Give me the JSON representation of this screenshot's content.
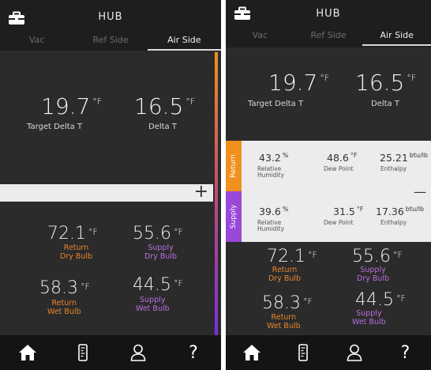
{
  "app": {
    "title": "HUB",
    "tabs": [
      "Vac",
      "Ref Side",
      "Air Side"
    ],
    "active_tab": "Air Side"
  },
  "delta": {
    "target_value": "19.7",
    "target_unit": "°F",
    "target_label": "Target Delta T",
    "actual_value": "16.5",
    "actual_unit": "°F",
    "actual_label": "Delta T"
  },
  "expand": {
    "plus": "+",
    "minus": "—"
  },
  "psychro": {
    "return_tag": "Return",
    "supply_tag": "Supply",
    "return": {
      "rh": "43.2",
      "rh_unit": "%",
      "rh_label": "Relative\nHumidity",
      "dew": "48.6",
      "dew_unit": "°F",
      "dew_label": "Dew Point",
      "enth": "25.21",
      "enth_unit": "btu/lb",
      "enth_label": "Enthalpy"
    },
    "supply": {
      "rh": "39.6",
      "rh_unit": "%",
      "rh_label": "Relative\nHumidity",
      "dew": "31.5",
      "dew_unit": "°F",
      "dew_label": "Dew Point",
      "enth": "17.36",
      "enth_unit": "btu/lb",
      "enth_label": "Enthalpy"
    }
  },
  "temps": {
    "return_dry": "72.1",
    "return_dry_label1": "Return",
    "return_dry_label2": "Dry Bulb",
    "supply_dry": "55.6",
    "supply_dry_label1": "Supply",
    "supply_dry_label2": "Dry Bulb",
    "return_wet": "58.3",
    "return_wet_label1": "Return",
    "return_wet_label2": "Wet Bulb",
    "supply_wet": "44.5",
    "supply_wet_label1": "Supply",
    "supply_wet_label2": "Wet Bulb",
    "unit": "°F"
  },
  "nav": {
    "help_label": "?"
  },
  "colors": {
    "return": "#e9862b",
    "supply": "#9a48d8",
    "band": "#ececec"
  },
  "icons": [
    "toolbox-icon",
    "home-icon",
    "gauge-icon",
    "user-icon",
    "help-icon"
  ]
}
